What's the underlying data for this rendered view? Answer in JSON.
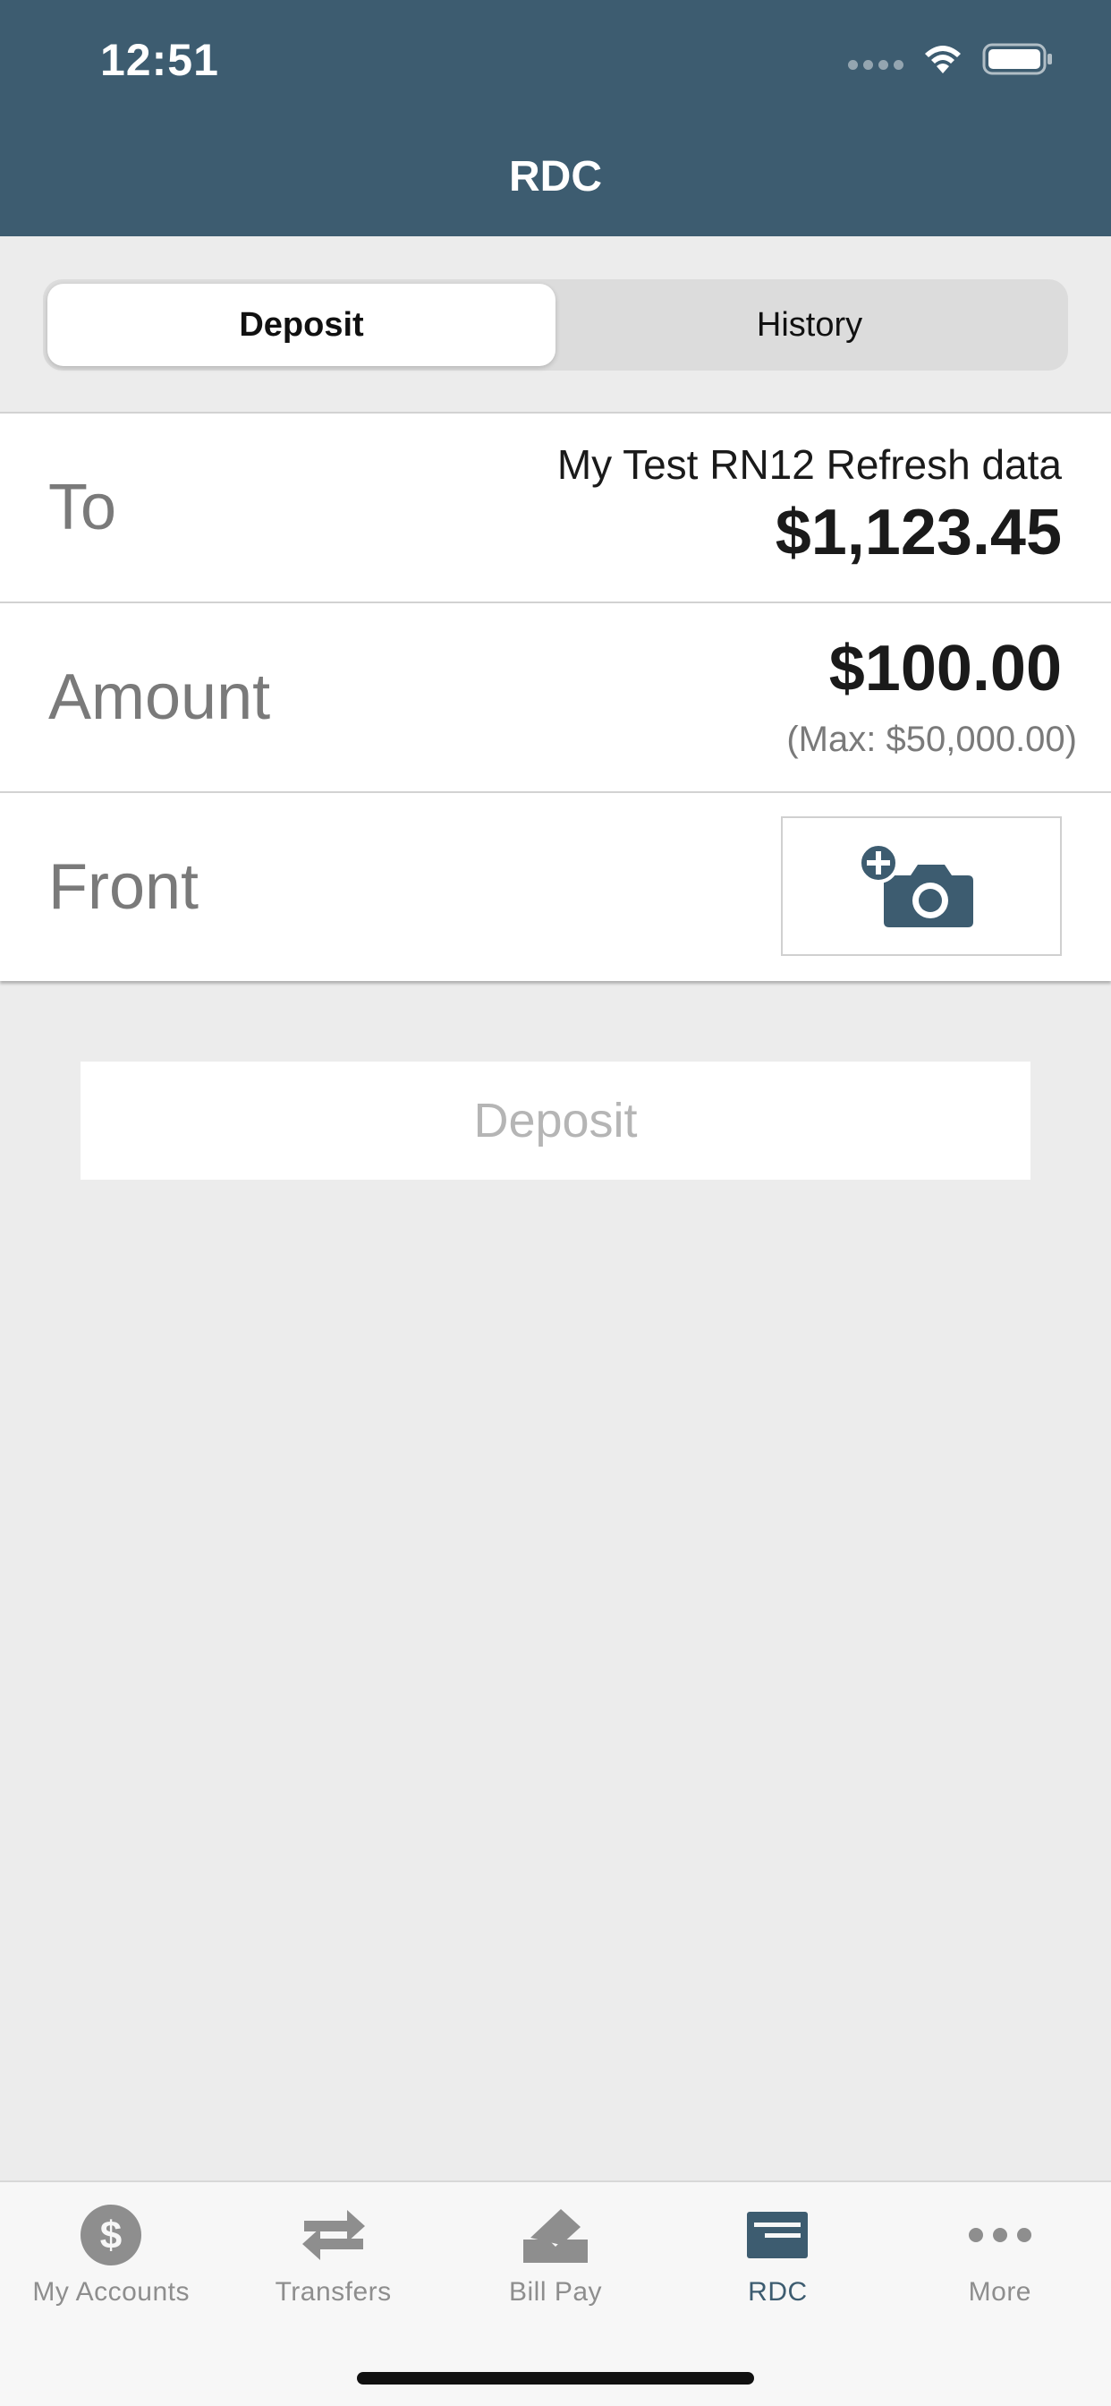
{
  "status_bar": {
    "time": "12:51"
  },
  "nav": {
    "title": "RDC"
  },
  "segments": {
    "deposit": "Deposit",
    "history": "History",
    "active": "deposit"
  },
  "form": {
    "to": {
      "label": "To",
      "account_name": "My Test RN12 Refresh data",
      "balance": "$1,123.45"
    },
    "amount": {
      "label": "Amount",
      "value": "$100.00",
      "max": "(Max: $50,000.00)"
    },
    "front": {
      "label": "Front",
      "icon": "add-camera-icon"
    }
  },
  "deposit_button": {
    "label": "Deposit"
  },
  "colors": {
    "brand": "#3d5c70",
    "background": "#ececec",
    "inactive_tab": "#8e8e8e"
  },
  "tabbar": {
    "items": [
      {
        "label": "My Accounts",
        "icon": "dollar-circle-icon"
      },
      {
        "label": "Transfers",
        "icon": "transfer-arrows-icon"
      },
      {
        "label": "Bill Pay",
        "icon": "bill-pay-icon"
      },
      {
        "label": "RDC",
        "icon": "check-deposit-icon",
        "active": true
      },
      {
        "label": "More",
        "icon": "more-dots-icon"
      }
    ]
  }
}
